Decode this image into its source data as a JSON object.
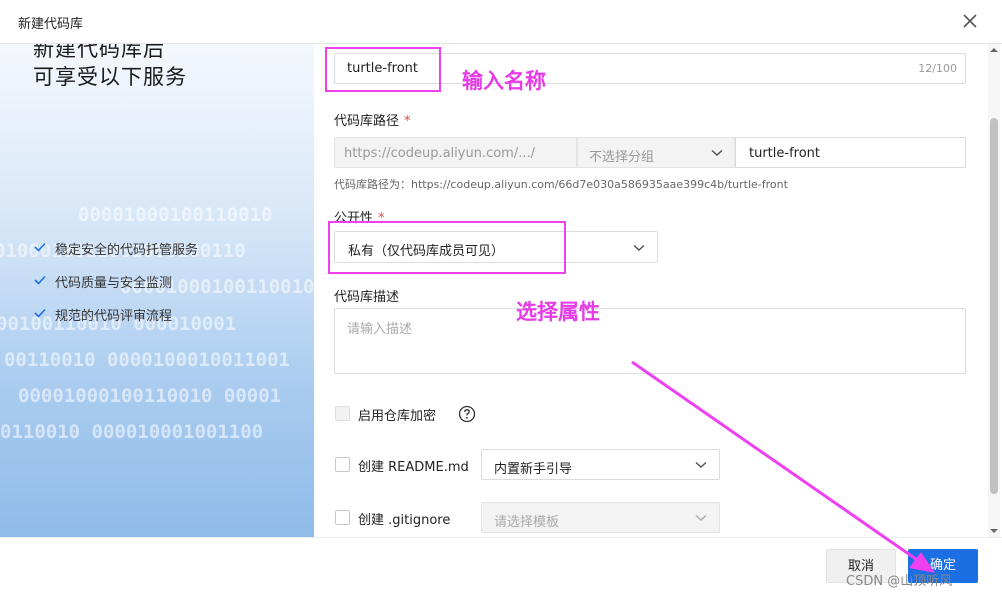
{
  "dialog": {
    "title": "新建代码库"
  },
  "promo": {
    "line1": "新建代码库后",
    "line2": "可享受以下服务",
    "binary_rows": [
      "00001000100110010",
      "0100010011001000100110",
      "00001000100110010",
      "00100110010  000010001",
      "00110010  0000100010011001",
      "00001000100110010  00001",
      "0110010  000010001001100"
    ],
    "features": [
      "稳定安全的代码托管服务",
      "代码质量与安全监测",
      "规范的代码评审流程"
    ]
  },
  "form": {
    "name": {
      "value": "turtle-front",
      "counter": "12/100"
    },
    "path": {
      "label": "代码库路径",
      "required_mark": "*",
      "prefix": "https://codeup.aliyun.com/.../",
      "group_placeholder": "不选择分组",
      "name_value": "turtle-front",
      "hint": "代码库路径为：https://codeup.aliyun.com/66d7e030a586935aae399c4b/turtle-front"
    },
    "visibility": {
      "label": "公开性",
      "required_mark": "*",
      "value": "私有（仅代码库成员可见）"
    },
    "description": {
      "label": "代码库描述",
      "placeholder": "请输入描述"
    },
    "encrypt": {
      "label": "启用仓库加密",
      "checked": false,
      "disabled": true
    },
    "readme": {
      "label": "创建 README.md",
      "checked": false,
      "template": "内置新手引导"
    },
    "gitignore": {
      "label": "创建 .gitignore",
      "checked": false,
      "template_placeholder": "请选择模板"
    }
  },
  "footer": {
    "cancel_label": "取消",
    "ok_label": "确定",
    "watermark": "CSDN @山顶听风"
  },
  "annotations": {
    "name_note": "输入名称",
    "visibility_note": "选择属性"
  },
  "colors": {
    "primary": "#1b6fe3",
    "annotation": "#e63be6",
    "check": "#1b6fe3"
  }
}
